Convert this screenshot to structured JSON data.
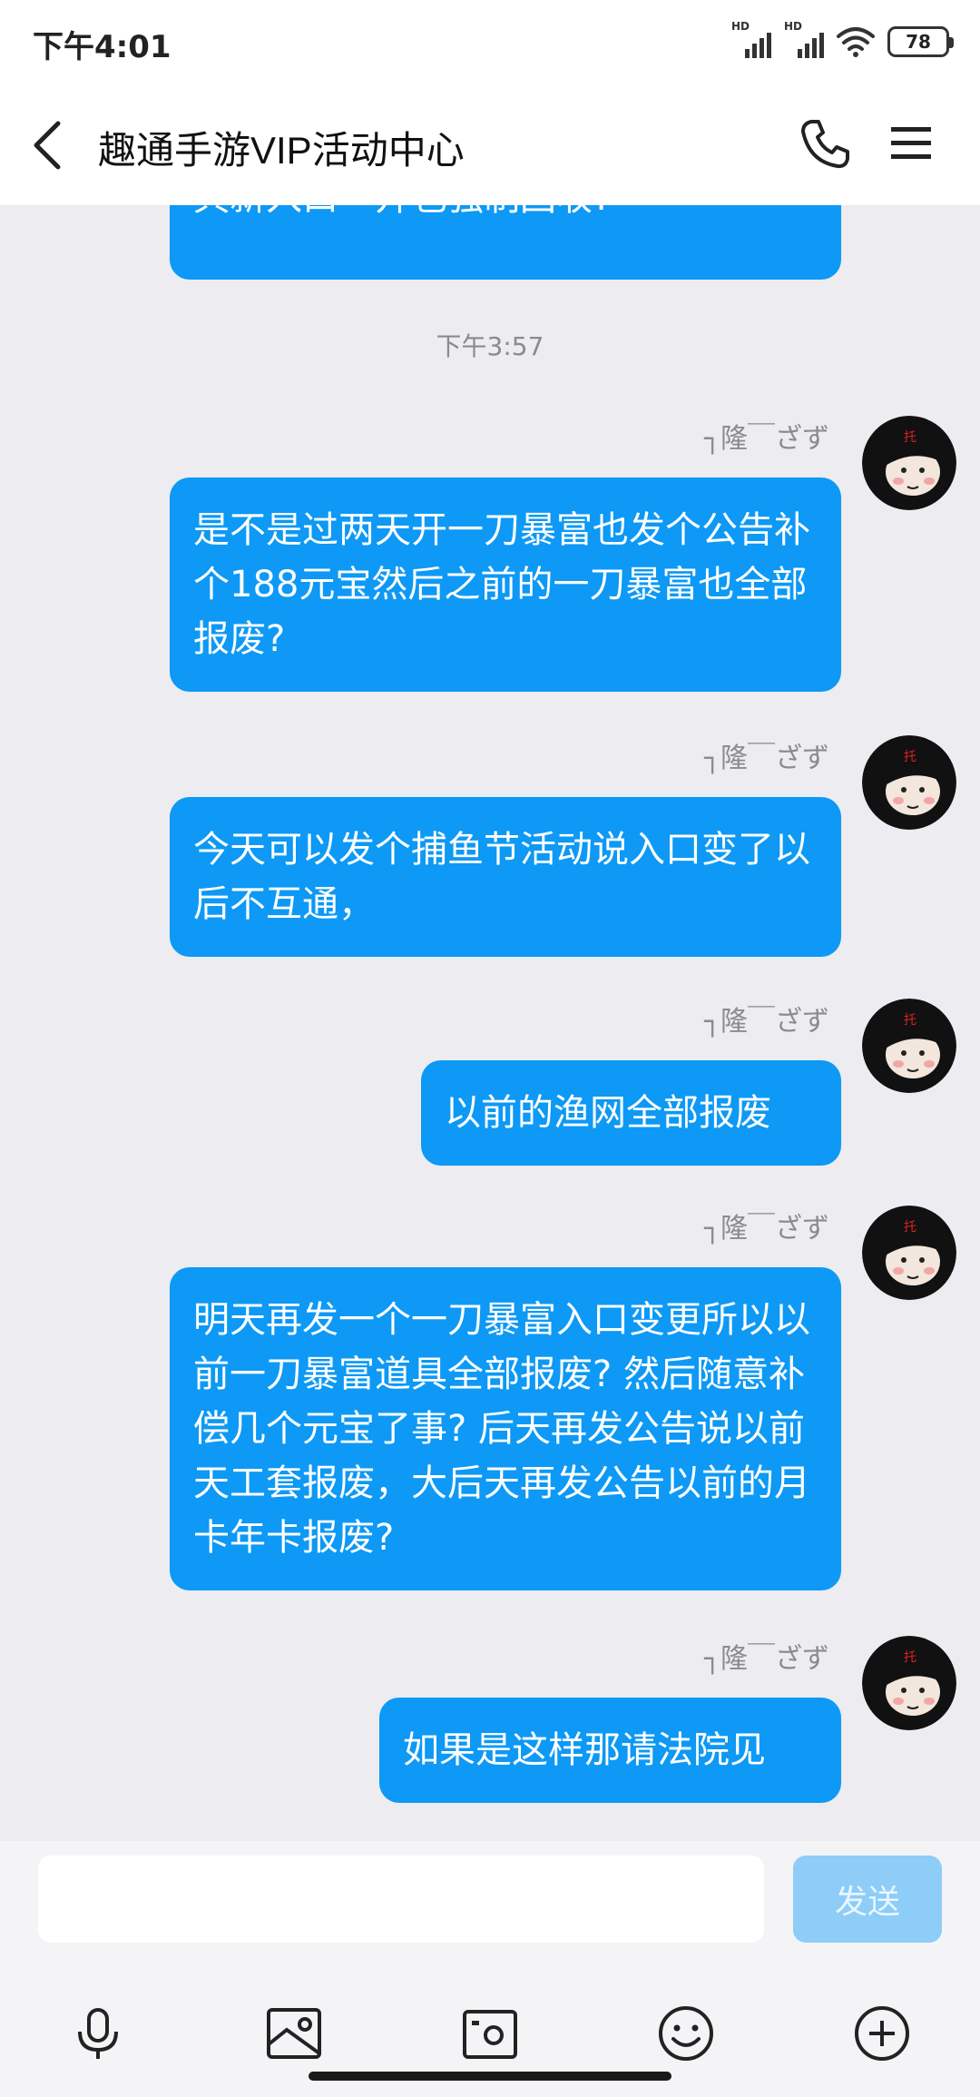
{
  "status_bar": {
    "time": "下午4:01",
    "signal_label_1": "HD",
    "signal_label_2": "HD",
    "battery": "78"
  },
  "header": {
    "title": "趣通手游VIP活动中心",
    "back_icon": "chevron-left-icon",
    "call_icon": "phone-icon",
    "menu_icon": "menu-icon"
  },
  "chat": {
    "partial_message": "具新入口一开也强制回收?",
    "timestamp": "下午3:57",
    "messages": [
      {
        "sender": "┐隆￣ざず",
        "text": "是不是过两天开一刀暴富也发个公告补个188元宝然后之前的一刀暴富也全部报废?"
      },
      {
        "sender": "┐隆￣ざず",
        "text": "今天可以发个捕鱼节活动说入口变了以后不互通，"
      },
      {
        "sender": "┐隆￣ざず",
        "text": "以前的渔网全部报废"
      },
      {
        "sender": "┐隆￣ざず",
        "text": "明天再发一个一刀暴富入口变更所以以前一刀暴富道具全部报废? 然后随意补偿几个元宝了事? 后天再发公告说以前天工套报废，大后天再发公告以前的月卡年卡报废?"
      },
      {
        "sender": "┐隆￣ざず",
        "text": "如果是这样那请法院见"
      }
    ]
  },
  "input_bar": {
    "placeholder": "",
    "send_label": "发送",
    "tools": [
      "microphone-icon",
      "image-icon",
      "camera-icon",
      "emoji-icon",
      "plus-circle-icon"
    ]
  },
  "colors": {
    "bubble": "#0d99f5",
    "background": "#ececf1",
    "send_disabled": "#8dcdf7"
  }
}
